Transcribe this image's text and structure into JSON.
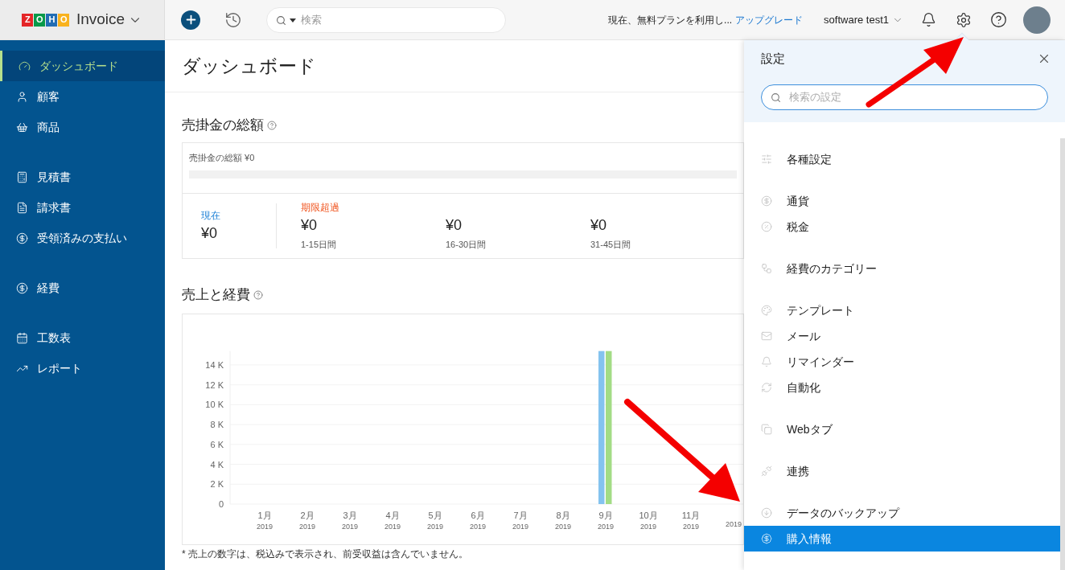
{
  "header": {
    "logo": {
      "letters": [
        {
          "char": "Z",
          "color": "#e42527"
        },
        {
          "char": "O",
          "color": "#089949"
        },
        {
          "char": "H",
          "color": "#226db4"
        },
        {
          "char": "O",
          "color": "#f9b21d"
        }
      ],
      "product": "Invoice"
    },
    "search": {
      "placeholder": "検索"
    },
    "trial_text": "現在、無料プランを利用し...",
    "upgrade_link": "アップグレード",
    "org_name": "software test1"
  },
  "sidebar": {
    "groups": [
      [
        {
          "label": "ダッシュボード",
          "selected": true
        },
        {
          "label": "顧客",
          "selected": false
        },
        {
          "label": "商品",
          "selected": false
        }
      ],
      [
        {
          "label": "見積書",
          "selected": false
        },
        {
          "label": "請求書",
          "selected": false
        },
        {
          "label": "受領済みの支払い",
          "selected": false
        }
      ],
      [
        {
          "label": "経費",
          "selected": false
        }
      ],
      [
        {
          "label": "工数表",
          "selected": false
        },
        {
          "label": "レポート",
          "selected": false
        }
      ]
    ]
  },
  "page_title": "ダッシュボード",
  "receivables": {
    "title": "売掛金の総額",
    "summary": "売掛金の総額 ¥0",
    "current": {
      "label": "現在",
      "amount": "¥0"
    },
    "overdue_label": "期限超過",
    "overdue": [
      {
        "amount": "¥0",
        "range": "1-15日間"
      },
      {
        "amount": "¥0",
        "range": "16-30日間"
      },
      {
        "amount": "¥0",
        "range": "31-45日間"
      }
    ]
  },
  "sales_expenses": {
    "title": "売上と経費",
    "footnote": "* 売上の数字は、税込みで表示され、前受収益は含んでいません。",
    "chart_data": {
      "type": "bar",
      "categories": [
        "1月\n2019",
        "2月\n2019",
        "3月\n2019",
        "4月\n2019",
        "5月\n2019",
        "6月\n2019",
        "7月\n2019",
        "8月\n2019",
        "9月\n2019",
        "10月\n2019",
        "11月\n2019",
        "2019"
      ],
      "yticks": [
        {
          "value": 0,
          "label": "0"
        },
        {
          "value": 2000,
          "label": "2 K"
        },
        {
          "value": 4000,
          "label": "4 K"
        },
        {
          "value": 6000,
          "label": "6 K"
        },
        {
          "value": 8000,
          "label": "8 K"
        },
        {
          "value": 10000,
          "label": "10 K"
        },
        {
          "value": 12000,
          "label": "12 K"
        },
        {
          "value": 14000,
          "label": "14 K"
        }
      ],
      "ylim": [
        0,
        15400
      ],
      "grid": true,
      "series": [
        {
          "color": "#84c3ef",
          "values": [
            0,
            0,
            0,
            0,
            0,
            0,
            0,
            0,
            15400,
            0,
            0,
            0
          ]
        },
        {
          "color": "#a3dc85",
          "values": [
            0,
            0,
            0,
            0,
            0,
            0,
            0,
            0,
            15400,
            0,
            0,
            0
          ]
        }
      ]
    }
  },
  "settings_panel": {
    "title": "設定",
    "search": {
      "placeholder": "検索の設定"
    },
    "groups": [
      [
        {
          "label": "各種設定",
          "selected": false
        }
      ],
      [
        {
          "label": "通貨",
          "selected": false
        },
        {
          "label": "税金",
          "selected": false
        }
      ],
      [
        {
          "label": "経費のカテゴリー",
          "selected": false
        }
      ],
      [
        {
          "label": "テンプレート",
          "selected": false
        },
        {
          "label": "メール",
          "selected": false
        },
        {
          "label": "リマインダー",
          "selected": false
        },
        {
          "label": "自動化",
          "selected": false
        }
      ],
      [
        {
          "label": "Webタブ",
          "selected": false
        }
      ],
      [
        {
          "label": "連携",
          "selected": false
        }
      ],
      [
        {
          "label": "データのバックアップ",
          "selected": false
        },
        {
          "label": "購入情報",
          "selected": true
        }
      ]
    ]
  }
}
